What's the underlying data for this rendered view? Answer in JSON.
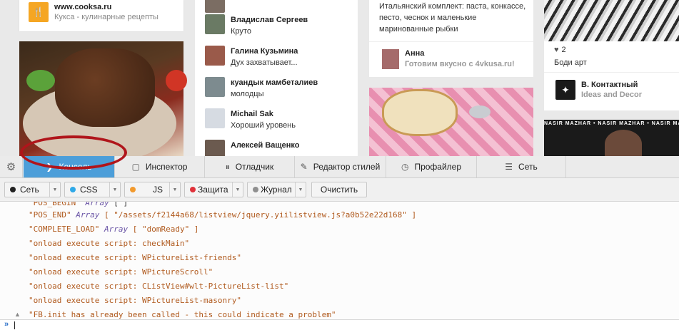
{
  "webpage": {
    "col1": {
      "source_site": "www.cooksa.ru",
      "source_title": "Кукса - кулинарные рецепты"
    },
    "col2": {
      "comments": [
        {
          "name": "Владислав Сергеев",
          "text": "Круто"
        },
        {
          "name": "Галина Кузьмина",
          "text": "Дух захватывает..."
        },
        {
          "name": "куандык мамбеталиев",
          "text": "молодцы"
        },
        {
          "name": "Michail Sak",
          "text": "Хороший уровень"
        },
        {
          "name": "Алексей Ващенко",
          "text": ""
        }
      ]
    },
    "col3": {
      "description": "Итальянский комплект: паста, конкассе, песто, чеснок и маленькие маринованные рыбки",
      "author_name": "Анна",
      "author_sub": "Готовим вкусно с 4vkusa.ru!"
    },
    "col4": {
      "likes": "2",
      "caption": "Боди арт",
      "group_name": "В. Контактный",
      "group_sub": "Ideas and Decor",
      "banner_text": "NASIR MAZHAR • NASIR MAZHAR • NASIR MAZHAR •"
    }
  },
  "devtools": {
    "tabs": [
      {
        "label": "Консоль",
        "icon": "console-chevron-icon",
        "active": true
      },
      {
        "label": "Инспектор",
        "icon": "inspector-icon",
        "active": false
      },
      {
        "label": "Отладчик",
        "icon": "debugger-icon",
        "active": false
      },
      {
        "label": "Редактор стилей",
        "icon": "style-editor-icon",
        "active": false
      },
      {
        "label": "Профайлер",
        "icon": "profiler-icon",
        "active": false
      },
      {
        "label": "Сеть",
        "icon": "network-icon",
        "active": false
      }
    ],
    "filters": [
      {
        "label": "Сеть",
        "color": "#222222"
      },
      {
        "label": "CSS",
        "color": "#2fa9e8"
      },
      {
        "label": "JS",
        "color": "#f29a2e"
      },
      {
        "label": "Защита",
        "color": "#e0313a"
      },
      {
        "label": "Журнал",
        "color": "#8f8f8f"
      }
    ],
    "clear_label": "Очистить",
    "console_lines": [
      {
        "key": "\"POS_BEGIN\"",
        "type": "Array",
        "value": "[ ]",
        "cut": true
      },
      {
        "key": "\"POS_END\"",
        "type": "Array",
        "value": "[ \"/assets/f2144a68/listview/jquery.yiilistview.js?a0b52e22d168\" ]"
      },
      {
        "key": "\"COMPLETE_LOAD\"",
        "type": "Array",
        "value": "[ \"domReady\" ]"
      },
      {
        "key": "\"onload execute script: checkMain\"",
        "type": "",
        "value": ""
      },
      {
        "key": "\"onload execute script: WPictureList-friends\"",
        "type": "",
        "value": ""
      },
      {
        "key": "\"onload execute script: WPictureScroll\"",
        "type": "",
        "value": ""
      },
      {
        "key": "\"onload execute script: CListView#wlt-PictureList-list\"",
        "type": "",
        "value": ""
      },
      {
        "key": "\"onload execute script: WPictureList-masonry\"",
        "type": "",
        "value": ""
      },
      {
        "key": "\"FB.init has already been called - this could indicate a problem\"",
        "type": "",
        "value": "",
        "warn": true
      }
    ],
    "prompt_symbol": "»"
  }
}
